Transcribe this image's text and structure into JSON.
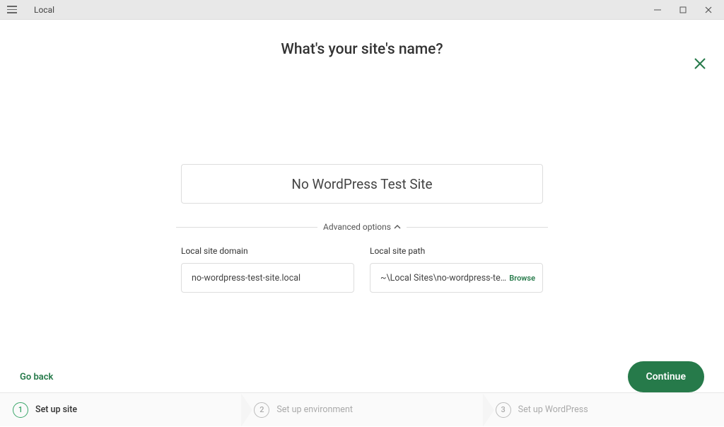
{
  "colors": {
    "accent": "#267a4a"
  },
  "window": {
    "title": "Local"
  },
  "heading": "What's your site's name?",
  "site_name": {
    "value": "No WordPress Test Site"
  },
  "advanced": {
    "label": "Advanced options"
  },
  "domain_field": {
    "label": "Local site domain",
    "value": "no-wordpress-test-site.local"
  },
  "path_field": {
    "label": "Local site path",
    "value": "~\\Local Sites\\no-wordpress-test-...",
    "browse": "Browse"
  },
  "actions": {
    "back": "Go back",
    "continue": "Continue"
  },
  "steps": [
    {
      "num": "1",
      "label": "Set up site",
      "active": true
    },
    {
      "num": "2",
      "label": "Set up environment",
      "active": false
    },
    {
      "num": "3",
      "label": "Set up WordPress",
      "active": false
    }
  ]
}
